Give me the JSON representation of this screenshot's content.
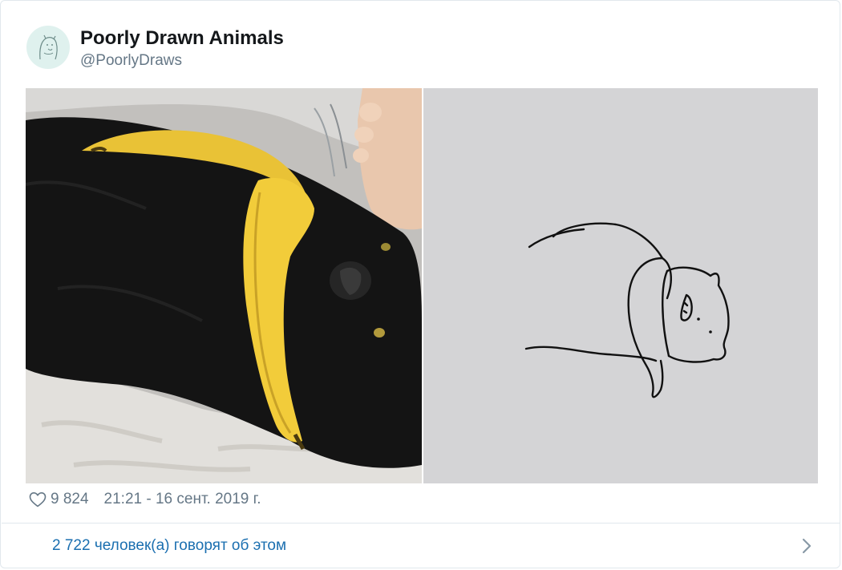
{
  "tweet": {
    "author": {
      "name": "Poorly Drawn Animals",
      "handle": "@PoorlyDraws"
    },
    "likes": "9 824",
    "timestamp": "21:21 - 16 сент. 2019 г.",
    "discussion": "2 722 человек(а) говорят об этом"
  },
  "media": {
    "left_image": "photo of black cat lying on blanket with a banana",
    "right_image": "simple line drawing of the cat with banana"
  },
  "icons": {
    "like": "heart-outline-icon",
    "more": "chevron-right-icon"
  },
  "colors": {
    "name": "#14171a",
    "secondary": "#657786",
    "link": "#1b6fb0",
    "border": "#e1e8ed",
    "avatar_bg": "#dff1ee"
  }
}
